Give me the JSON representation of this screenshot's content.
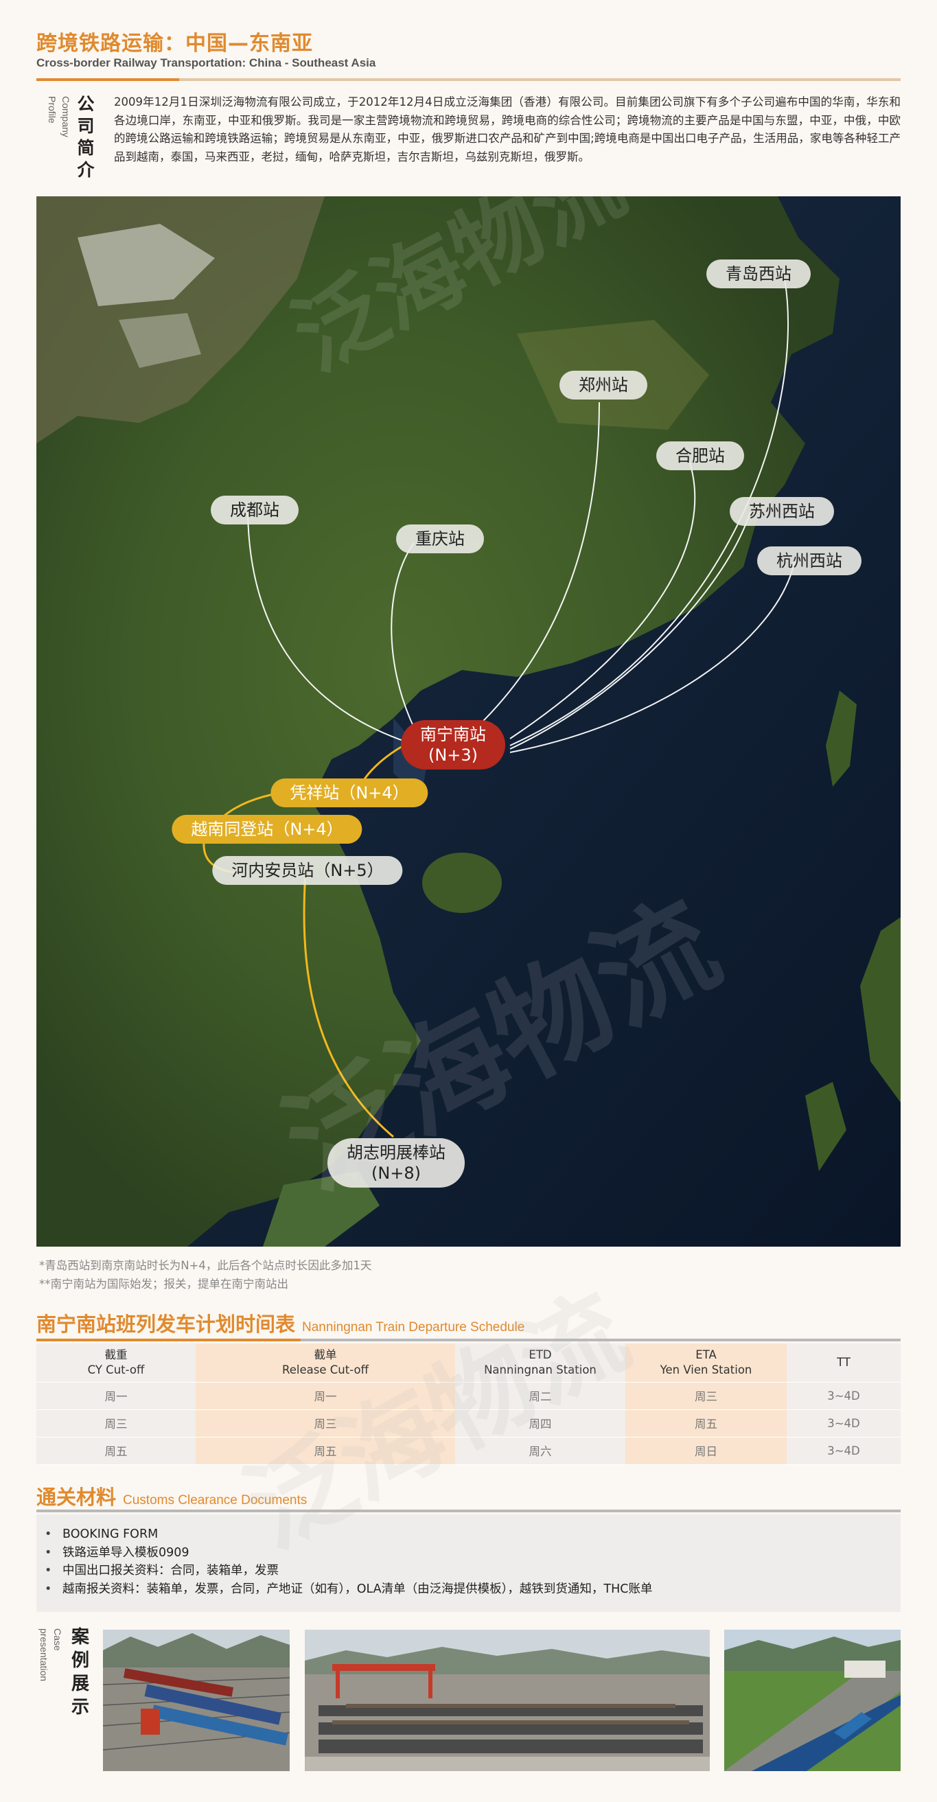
{
  "header": {
    "title_cn": "跨境铁路运输：中国—东南亚",
    "title_en": "Cross-border Railway Transportation: China - Southeast Asia"
  },
  "profile": {
    "label_en": "Company Profile",
    "label_cn": "公司简介",
    "text": "2009年12月1日深圳泛海物流有限公司成立，于2012年12月4日成立泛海集团（香港）有限公司。目前集团公司旗下有多个子公司遍布中国的华南，华东和各边境口岸，东南亚，中亚和俄罗斯。我司是一家主营跨境物流和跨境贸易，跨境电商的综合性公司；跨境物流的主要产品是中国与东盟，中亚，中俄，中欧的跨境公路运输和跨境铁路运输；跨境贸易是从东南亚，中亚，俄罗斯进口农产品和矿产到中国;跨境电商是中国出口电子产品，生活用品，家电等各种轻工产品到越南，泰国，马来西亚，老挝，缅甸，哈萨克斯坦，吉尔吉斯坦，乌兹别克斯坦，俄罗斯。"
  },
  "map": {
    "watermark": "泛海物流",
    "stations": {
      "qingdao": "青岛西站",
      "zhengzhou": "郑州站",
      "hefei": "合肥站",
      "chengdu": "成都站",
      "chongqing": "重庆站",
      "suzhou": "苏州西站",
      "hangzhou": "杭州西站",
      "nanning_name": "南宁南站",
      "nanning_time": "(N+3)",
      "pingxiang": "凭祥站（N+4）",
      "dong_dang": "越南同登站（N+4）",
      "yen_vien": "河内安员站（N+5）",
      "hcmc_name": "胡志明展棒站",
      "hcmc_time": "(N+8)"
    },
    "colors": {
      "hub": "#b52a1e",
      "border_route": "#e2ae24",
      "china_route": "#ffffff"
    }
  },
  "notes": [
    "*青岛西站到南京南站时长为N+4，此后各个站点时长因此多加1天",
    "**南宁南站为国际始发；报关，提单在南宁南站出"
  ],
  "schedule": {
    "heading_cn": "南宁南站班列发车计划时间表",
    "heading_en": "Nanningnan Train Departure Schedule",
    "headers": [
      {
        "l1": "截重",
        "l2": "CY Cut-off"
      },
      {
        "l1": "截单",
        "l2": "Release Cut-off"
      },
      {
        "l1": "ETD",
        "l2": "Nanningnan Station"
      },
      {
        "l1": "ETA",
        "l2": "Yen Vien Station"
      },
      {
        "l1": "TT",
        "l2": ""
      }
    ],
    "rows": [
      [
        "周一",
        "周一",
        "周二",
        "周三",
        "3~4D"
      ],
      [
        "周三",
        "周三",
        "周四",
        "周五",
        "3~4D"
      ],
      [
        "周五",
        "周五",
        "周六",
        "周日",
        "3~4D"
      ]
    ]
  },
  "customs": {
    "heading_cn": "通关材料",
    "heading_en": "Customs Clearance Documents",
    "items": [
      "BOOKING FORM",
      "铁路运单导入模板0909",
      "中国出口报关资料：合同，装箱单，发票",
      "越南报关资料：装箱单，发票，合同，产地证（如有），OLA清单（由泛海提供模板），越铁到货通知，THC账单"
    ]
  },
  "cases": {
    "label_en": "Case presentation",
    "label_cn": "案例展示"
  }
}
